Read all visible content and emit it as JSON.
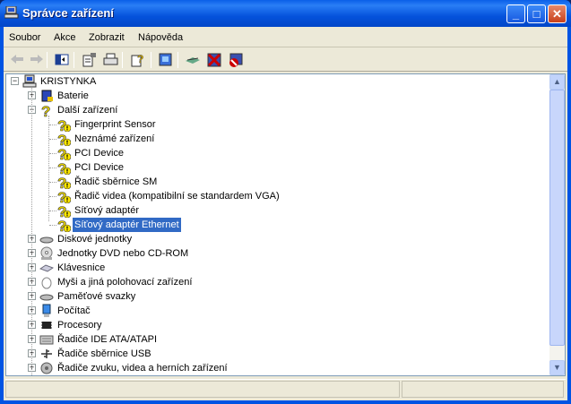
{
  "window": {
    "title": "Správce zařízení"
  },
  "titlebar_buttons": {
    "minimize": "_",
    "maximize": "□",
    "close": "✕"
  },
  "menu": [
    "Soubor",
    "Akce",
    "Zobrazit",
    "Nápověda"
  ],
  "toolbar": [
    "back-icon",
    "forward-icon",
    "show-hide-tree-icon",
    "properties-icon",
    "print-icon",
    "help-icon",
    "scan-hardware-icon",
    "update-driver-icon",
    "uninstall-icon",
    "disable-icon"
  ],
  "tree": {
    "root": "KRISTYNKA",
    "items": [
      {
        "label": "Baterie",
        "level": 1,
        "expander": "+",
        "icon": "battery-icon"
      },
      {
        "label": "Další zařízení",
        "level": 1,
        "expander": "−",
        "icon": "unknown-device-icon"
      },
      {
        "label": "Fingerprint Sensor",
        "level": 2,
        "icon": "warning-device-icon"
      },
      {
        "label": "Neznámé zařízení",
        "level": 2,
        "icon": "warning-device-icon"
      },
      {
        "label": "PCI Device",
        "level": 2,
        "icon": "warning-device-icon"
      },
      {
        "label": "PCI Device",
        "level": 2,
        "icon": "warning-device-icon"
      },
      {
        "label": "Řadič sběrnice SM",
        "level": 2,
        "icon": "warning-device-icon"
      },
      {
        "label": "Řadič videa (kompatibilní se standardem VGA)",
        "level": 2,
        "icon": "warning-device-icon"
      },
      {
        "label": "Síťový adaptér",
        "level": 2,
        "icon": "warning-device-icon"
      },
      {
        "label": "Síťový adaptér Ethernet",
        "level": 2,
        "icon": "warning-device-icon",
        "selected": true
      },
      {
        "label": "Diskové jednotky",
        "level": 1,
        "expander": "+",
        "icon": "disk-icon"
      },
      {
        "label": "Jednotky DVD nebo CD-ROM",
        "level": 1,
        "expander": "+",
        "icon": "cdrom-icon"
      },
      {
        "label": "Klávesnice",
        "level": 1,
        "expander": "+",
        "icon": "keyboard-icon"
      },
      {
        "label": "Myši a jiná polohovací zařízení",
        "level": 1,
        "expander": "+",
        "icon": "mouse-icon"
      },
      {
        "label": "Paměťové svazky",
        "level": 1,
        "expander": "+",
        "icon": "volume-icon"
      },
      {
        "label": "Počítač",
        "level": 1,
        "expander": "+",
        "icon": "computer-icon"
      },
      {
        "label": "Procesory",
        "level": 1,
        "expander": "+",
        "icon": "processor-icon"
      },
      {
        "label": "Řadiče IDE ATA/ATAPI",
        "level": 1,
        "expander": "+",
        "icon": "ide-icon"
      },
      {
        "label": "Řadiče sběrnice USB",
        "level": 1,
        "expander": "+",
        "icon": "usb-icon"
      },
      {
        "label": "Řadiče zvuku, videa a herních zařízení",
        "level": 1,
        "expander": "+",
        "icon": "sound-icon"
      }
    ]
  },
  "colors": {
    "selection": "#316ac5",
    "titlebar": "#0054e3",
    "face": "#ece9d8"
  }
}
